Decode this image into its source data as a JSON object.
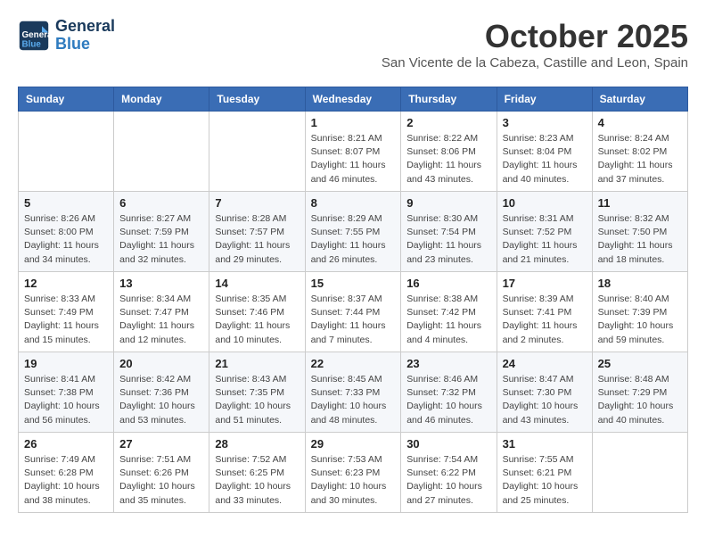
{
  "header": {
    "logo_line1": "General",
    "logo_line2": "Blue",
    "month_title": "October 2025",
    "location": "San Vicente de la Cabeza, Castille and Leon, Spain"
  },
  "weekdays": [
    "Sunday",
    "Monday",
    "Tuesday",
    "Wednesday",
    "Thursday",
    "Friday",
    "Saturday"
  ],
  "weeks": [
    [
      {
        "day": "",
        "sunrise": "",
        "sunset": "",
        "daylight": ""
      },
      {
        "day": "",
        "sunrise": "",
        "sunset": "",
        "daylight": ""
      },
      {
        "day": "",
        "sunrise": "",
        "sunset": "",
        "daylight": ""
      },
      {
        "day": "1",
        "sunrise": "Sunrise: 8:21 AM",
        "sunset": "Sunset: 8:07 PM",
        "daylight": "Daylight: 11 hours and 46 minutes."
      },
      {
        "day": "2",
        "sunrise": "Sunrise: 8:22 AM",
        "sunset": "Sunset: 8:06 PM",
        "daylight": "Daylight: 11 hours and 43 minutes."
      },
      {
        "day": "3",
        "sunrise": "Sunrise: 8:23 AM",
        "sunset": "Sunset: 8:04 PM",
        "daylight": "Daylight: 11 hours and 40 minutes."
      },
      {
        "day": "4",
        "sunrise": "Sunrise: 8:24 AM",
        "sunset": "Sunset: 8:02 PM",
        "daylight": "Daylight: 11 hours and 37 minutes."
      }
    ],
    [
      {
        "day": "5",
        "sunrise": "Sunrise: 8:26 AM",
        "sunset": "Sunset: 8:00 PM",
        "daylight": "Daylight: 11 hours and 34 minutes."
      },
      {
        "day": "6",
        "sunrise": "Sunrise: 8:27 AM",
        "sunset": "Sunset: 7:59 PM",
        "daylight": "Daylight: 11 hours and 32 minutes."
      },
      {
        "day": "7",
        "sunrise": "Sunrise: 8:28 AM",
        "sunset": "Sunset: 7:57 PM",
        "daylight": "Daylight: 11 hours and 29 minutes."
      },
      {
        "day": "8",
        "sunrise": "Sunrise: 8:29 AM",
        "sunset": "Sunset: 7:55 PM",
        "daylight": "Daylight: 11 hours and 26 minutes."
      },
      {
        "day": "9",
        "sunrise": "Sunrise: 8:30 AM",
        "sunset": "Sunset: 7:54 PM",
        "daylight": "Daylight: 11 hours and 23 minutes."
      },
      {
        "day": "10",
        "sunrise": "Sunrise: 8:31 AM",
        "sunset": "Sunset: 7:52 PM",
        "daylight": "Daylight: 11 hours and 21 minutes."
      },
      {
        "day": "11",
        "sunrise": "Sunrise: 8:32 AM",
        "sunset": "Sunset: 7:50 PM",
        "daylight": "Daylight: 11 hours and 18 minutes."
      }
    ],
    [
      {
        "day": "12",
        "sunrise": "Sunrise: 8:33 AM",
        "sunset": "Sunset: 7:49 PM",
        "daylight": "Daylight: 11 hours and 15 minutes."
      },
      {
        "day": "13",
        "sunrise": "Sunrise: 8:34 AM",
        "sunset": "Sunset: 7:47 PM",
        "daylight": "Daylight: 11 hours and 12 minutes."
      },
      {
        "day": "14",
        "sunrise": "Sunrise: 8:35 AM",
        "sunset": "Sunset: 7:46 PM",
        "daylight": "Daylight: 11 hours and 10 minutes."
      },
      {
        "day": "15",
        "sunrise": "Sunrise: 8:37 AM",
        "sunset": "Sunset: 7:44 PM",
        "daylight": "Daylight: 11 hours and 7 minutes."
      },
      {
        "day": "16",
        "sunrise": "Sunrise: 8:38 AM",
        "sunset": "Sunset: 7:42 PM",
        "daylight": "Daylight: 11 hours and 4 minutes."
      },
      {
        "day": "17",
        "sunrise": "Sunrise: 8:39 AM",
        "sunset": "Sunset: 7:41 PM",
        "daylight": "Daylight: 11 hours and 2 minutes."
      },
      {
        "day": "18",
        "sunrise": "Sunrise: 8:40 AM",
        "sunset": "Sunset: 7:39 PM",
        "daylight": "Daylight: 10 hours and 59 minutes."
      }
    ],
    [
      {
        "day": "19",
        "sunrise": "Sunrise: 8:41 AM",
        "sunset": "Sunset: 7:38 PM",
        "daylight": "Daylight: 10 hours and 56 minutes."
      },
      {
        "day": "20",
        "sunrise": "Sunrise: 8:42 AM",
        "sunset": "Sunset: 7:36 PM",
        "daylight": "Daylight: 10 hours and 53 minutes."
      },
      {
        "day": "21",
        "sunrise": "Sunrise: 8:43 AM",
        "sunset": "Sunset: 7:35 PM",
        "daylight": "Daylight: 10 hours and 51 minutes."
      },
      {
        "day": "22",
        "sunrise": "Sunrise: 8:45 AM",
        "sunset": "Sunset: 7:33 PM",
        "daylight": "Daylight: 10 hours and 48 minutes."
      },
      {
        "day": "23",
        "sunrise": "Sunrise: 8:46 AM",
        "sunset": "Sunset: 7:32 PM",
        "daylight": "Daylight: 10 hours and 46 minutes."
      },
      {
        "day": "24",
        "sunrise": "Sunrise: 8:47 AM",
        "sunset": "Sunset: 7:30 PM",
        "daylight": "Daylight: 10 hours and 43 minutes."
      },
      {
        "day": "25",
        "sunrise": "Sunrise: 8:48 AM",
        "sunset": "Sunset: 7:29 PM",
        "daylight": "Daylight: 10 hours and 40 minutes."
      }
    ],
    [
      {
        "day": "26",
        "sunrise": "Sunrise: 7:49 AM",
        "sunset": "Sunset: 6:28 PM",
        "daylight": "Daylight: 10 hours and 38 minutes."
      },
      {
        "day": "27",
        "sunrise": "Sunrise: 7:51 AM",
        "sunset": "Sunset: 6:26 PM",
        "daylight": "Daylight: 10 hours and 35 minutes."
      },
      {
        "day": "28",
        "sunrise": "Sunrise: 7:52 AM",
        "sunset": "Sunset: 6:25 PM",
        "daylight": "Daylight: 10 hours and 33 minutes."
      },
      {
        "day": "29",
        "sunrise": "Sunrise: 7:53 AM",
        "sunset": "Sunset: 6:23 PM",
        "daylight": "Daylight: 10 hours and 30 minutes."
      },
      {
        "day": "30",
        "sunrise": "Sunrise: 7:54 AM",
        "sunset": "Sunset: 6:22 PM",
        "daylight": "Daylight: 10 hours and 27 minutes."
      },
      {
        "day": "31",
        "sunrise": "Sunrise: 7:55 AM",
        "sunset": "Sunset: 6:21 PM",
        "daylight": "Daylight: 10 hours and 25 minutes."
      },
      {
        "day": "",
        "sunrise": "",
        "sunset": "",
        "daylight": ""
      }
    ]
  ]
}
